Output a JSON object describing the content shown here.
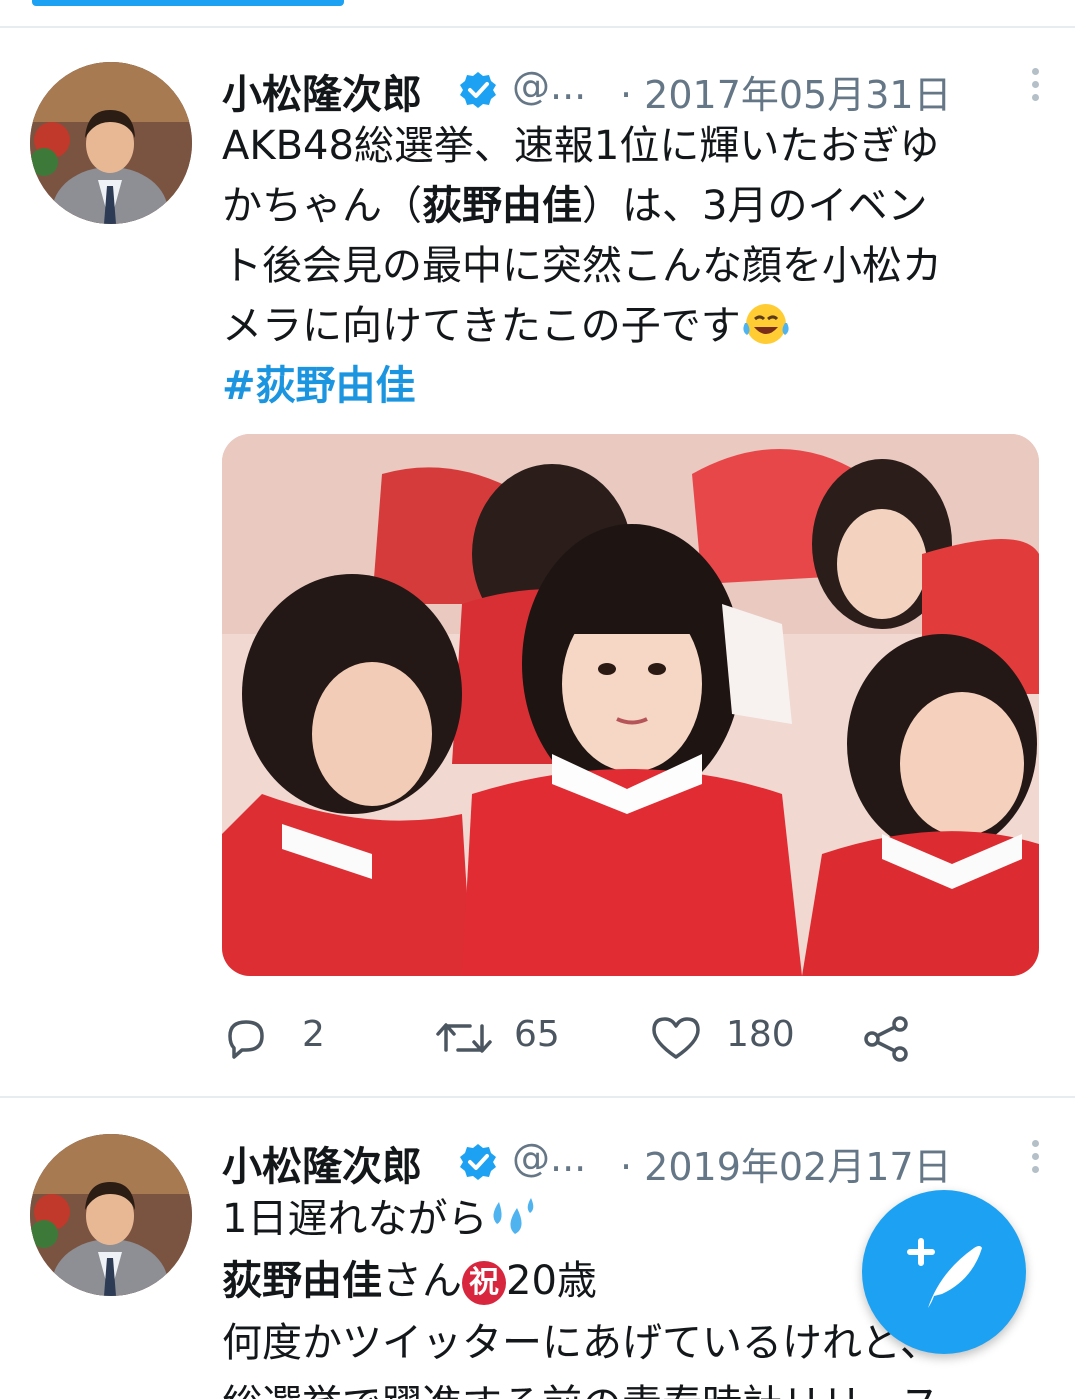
{
  "tweets": [
    {
      "author_name": "小松隆次郎",
      "handle": "@...",
      "date": "· 2017年05月31日",
      "lines": [
        "AKB48総選挙、速報1位に輝いたおぎゆ",
        [
          "かちゃん（",
          "荻野由佳",
          "）は、3月のイベン"
        ],
        "ト後会見の最中に突然こんな顔を小松カ",
        "メラに向けてきたこの子です"
      ],
      "hashtag": "#荻野由佳",
      "reply_count": "2",
      "retweet_count": "65",
      "like_count": "180"
    },
    {
      "author_name": "小松隆次郎",
      "handle": "@...",
      "date": "· 2019年02月17日",
      "line1": "1日遅れながら",
      "line2_bold": "荻野由佳",
      "line2_rest": "さん",
      "line2_badge": "祝",
      "line2_tail": "20歳",
      "line3": "何度かツイッターにあげているけれど、",
      "line4": "総選挙で躍進する前の青春時計リリース"
    }
  ],
  "colors": {
    "accent": "#1da1f2",
    "hashtag": "#1b95e0",
    "secondary_text": "#657786"
  },
  "icons": [
    "verified-badge-icon",
    "more-vertical-icon",
    "reply-icon",
    "retweet-icon",
    "like-icon",
    "share-icon",
    "compose-tweet-icon",
    "laughing-tears-emoji",
    "sweat-droplets-emoji"
  ]
}
